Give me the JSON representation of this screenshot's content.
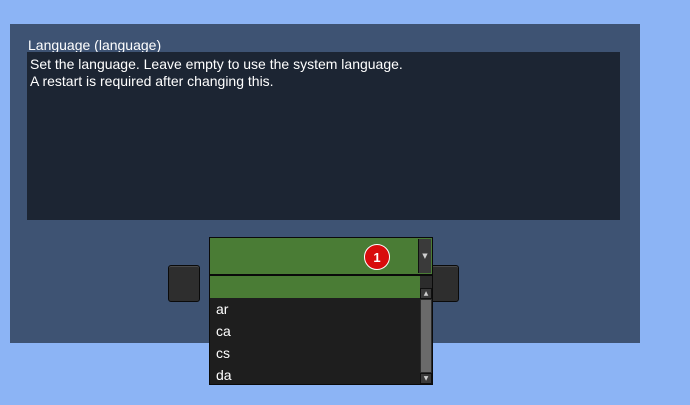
{
  "setting": {
    "title": "Language (language)",
    "description": [
      "Set the language. Leave empty to use the system language.",
      "A restart is required after changing this."
    ]
  },
  "combo": {
    "value": "",
    "arrow_icon": "chevron-down-icon",
    "badge": "1"
  },
  "dropdown": {
    "options": [
      "",
      "ar",
      "ca",
      "cs",
      "da"
    ],
    "selected_index": 0
  },
  "colors": {
    "background": "#8cb4f5",
    "dialog": "#3e5373",
    "description_bg": "#1c2533",
    "selection": "#4a7c35",
    "popup_bg": "#1e1e1e",
    "badge": "#d80c0c"
  }
}
